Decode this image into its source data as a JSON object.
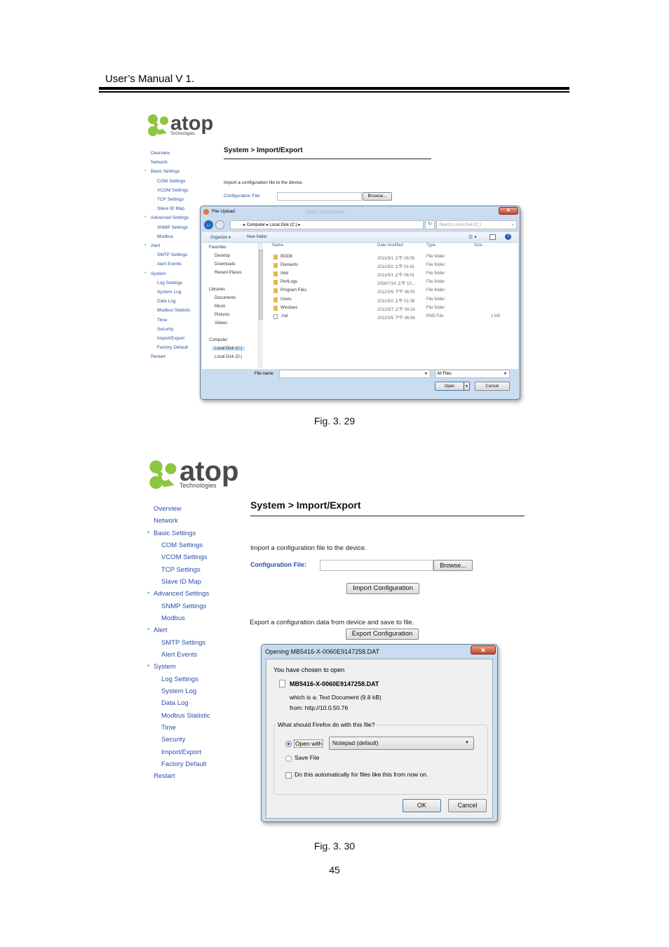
{
  "header": {
    "title": "User’s Manual V 1."
  },
  "logo": {
    "word": "atop",
    "sub": "Technologies",
    "colors": {
      "green": "#8dc63f",
      "text": "#4a4a4a"
    }
  },
  "sidebar": {
    "items": [
      {
        "label": "Overview",
        "level": 0
      },
      {
        "label": "Network",
        "level": 0
      },
      {
        "label": "Basic Settings",
        "level": 0,
        "bullet": true
      },
      {
        "label": "COM Settings",
        "level": 1
      },
      {
        "label": "VCOM Settings",
        "level": 1
      },
      {
        "label": "TCP Settings",
        "level": 1
      },
      {
        "label": "Slave ID Map",
        "level": 1
      },
      {
        "label": "Advanced Settings",
        "level": 0,
        "bullet": true
      },
      {
        "label": "SNMP Settings",
        "level": 1
      },
      {
        "label": "Modbus",
        "level": 1
      },
      {
        "label": "Alert",
        "level": 0,
        "bullet": true
      },
      {
        "label": "SMTP Settings",
        "level": 1
      },
      {
        "label": "Alert Events",
        "level": 1
      },
      {
        "label": "System",
        "level": 0,
        "bullet": true
      },
      {
        "label": "Log Settings",
        "level": 1
      },
      {
        "label": "System Log",
        "level": 1
      },
      {
        "label": "Data Log",
        "level": 1
      },
      {
        "label": "Modbus Statistic",
        "level": 1
      },
      {
        "label": "Time",
        "level": 1
      },
      {
        "label": "Security",
        "level": 1
      },
      {
        "label": "Import/Export",
        "level": 1
      },
      {
        "label": "Factory Default",
        "level": 1
      },
      {
        "label": "Restart",
        "level": 0
      }
    ]
  },
  "page": {
    "title": "System > Import/Export",
    "import_text": "Import a configuration file to the device.",
    "config_label": "Configuration File:",
    "browse": "Browse...",
    "import_btn": "Import Configuration",
    "export_text": "Export a configuration data from device and save to file.",
    "export_btn": "Export Configuration"
  },
  "file_upload": {
    "title": "File Upload",
    "bg_button": "Import Configuration",
    "path": [
      "Computer",
      "Local Disk (C:)"
    ],
    "search_placeholder": "Search Local Disk (C:)",
    "organize": "Organize ▾",
    "new_folder": "New folder",
    "nav": [
      "Favorites",
      "Desktop",
      "Downloads",
      "Recent Places",
      "Libraries",
      "Documents",
      "Music",
      "Pictures",
      "Videos",
      "Computer",
      "Local Disk (C:)",
      "Local Disk (D:)"
    ],
    "columns": [
      "Name",
      "Date modified",
      "Type",
      "Size"
    ],
    "files": [
      [
        "BOOK",
        "2011/9/1 上午 06:35",
        "File folder",
        ""
      ],
      [
        "Elements",
        "2011/9/2 上午 01:41",
        "File folder",
        ""
      ],
      [
        "Intel",
        "2011/9/1 上午 06:01",
        "File folder",
        ""
      ],
      [
        "PerfLogs",
        "2009/7/14 上午 10:...",
        "File folder",
        ""
      ],
      [
        "Program Files",
        "2012/3/5 下午 06:05",
        "File folder",
        ""
      ],
      [
        "Users",
        "2011/9/2 上午 01:39",
        "File folder",
        ""
      ],
      [
        "Windows",
        "2012/3/7 上午 09:16",
        "File folder",
        ""
      ],
      [
        ".rnd",
        "2012/3/5 下午 06:06",
        "RND File",
        "1 KB"
      ]
    ],
    "file_name_label": "File name:",
    "file_name_value": "",
    "filter": "All Files",
    "open": "Open",
    "cancel": "Cancel"
  },
  "open_dialog": {
    "title": "Opening MB5416-X-0060E9147258.DAT",
    "chosen": "You have chosen to open",
    "filename": "MB5416-X-0060E9147258.DAT",
    "which_label": "which is a:",
    "which_value": "Text Document (9.8 kB)",
    "from_label": "from:",
    "from_value": "http://10.0.50.76",
    "question": "What should Firefox do with this file?",
    "open_with": "Open with",
    "app": "Notepad (default)",
    "save_file": "Save File",
    "auto": "Do this automatically for files like this from now on.",
    "ok": "OK",
    "cancel": "Cancel",
    "selected": "open_with",
    "auto_checked": false
  },
  "captions": {
    "fig1": "Fig. 3. 29",
    "fig2": "Fig. 3. 30"
  },
  "page_number": "45"
}
